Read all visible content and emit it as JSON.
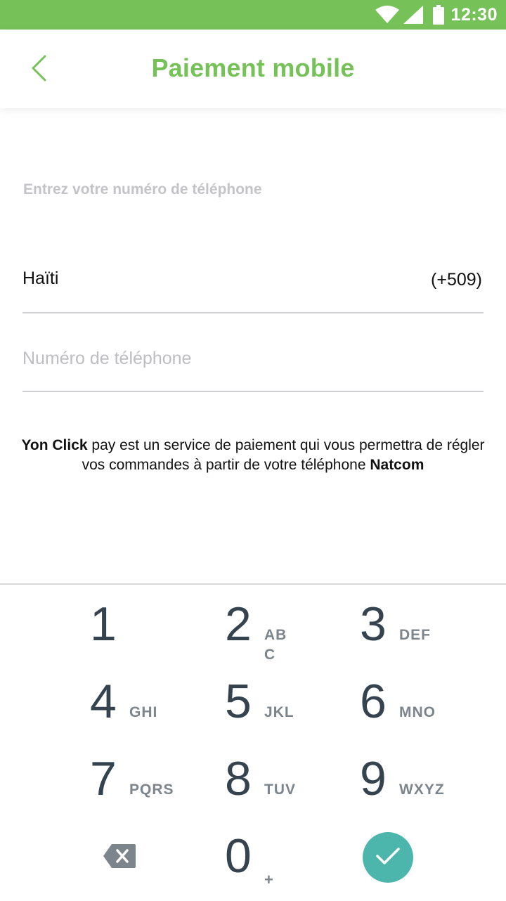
{
  "status_bar": {
    "time": "12:30",
    "icons": [
      "wifi-icon",
      "signal-icon",
      "battery-icon"
    ],
    "background": "#76c258"
  },
  "app_bar": {
    "back_icon": "chevron-left-icon",
    "title": "Paiement mobile",
    "accent_color": "#76c258"
  },
  "form": {
    "label": "Entrez votre numéro de téléphone",
    "country": {
      "name": "Haïti",
      "code": "(+509)"
    },
    "phone": {
      "value": "",
      "placeholder": "Numéro de téléphone"
    }
  },
  "info": {
    "brand": "Yon Click",
    "text_middle": " pay est un service de paiement qui vous permettra de régler vos commandes à partir de votre téléphone ",
    "operator": "Natcom"
  },
  "keypad": {
    "keys": [
      {
        "digit": "1",
        "letters": ""
      },
      {
        "digit": "2",
        "letters": "ABC"
      },
      {
        "digit": "3",
        "letters": "DEF"
      },
      {
        "digit": "4",
        "letters": "GHI"
      },
      {
        "digit": "5",
        "letters": "JKL"
      },
      {
        "digit": "6",
        "letters": "MNO"
      },
      {
        "digit": "7",
        "letters": "PQRS"
      },
      {
        "digit": "8",
        "letters": "TUV"
      },
      {
        "digit": "9",
        "letters": "WXYZ"
      },
      {
        "digit": "0",
        "letters": "+"
      }
    ],
    "backspace_icon": "backspace-icon",
    "confirm_icon": "check-icon",
    "confirm_color": "#4db6ac"
  }
}
